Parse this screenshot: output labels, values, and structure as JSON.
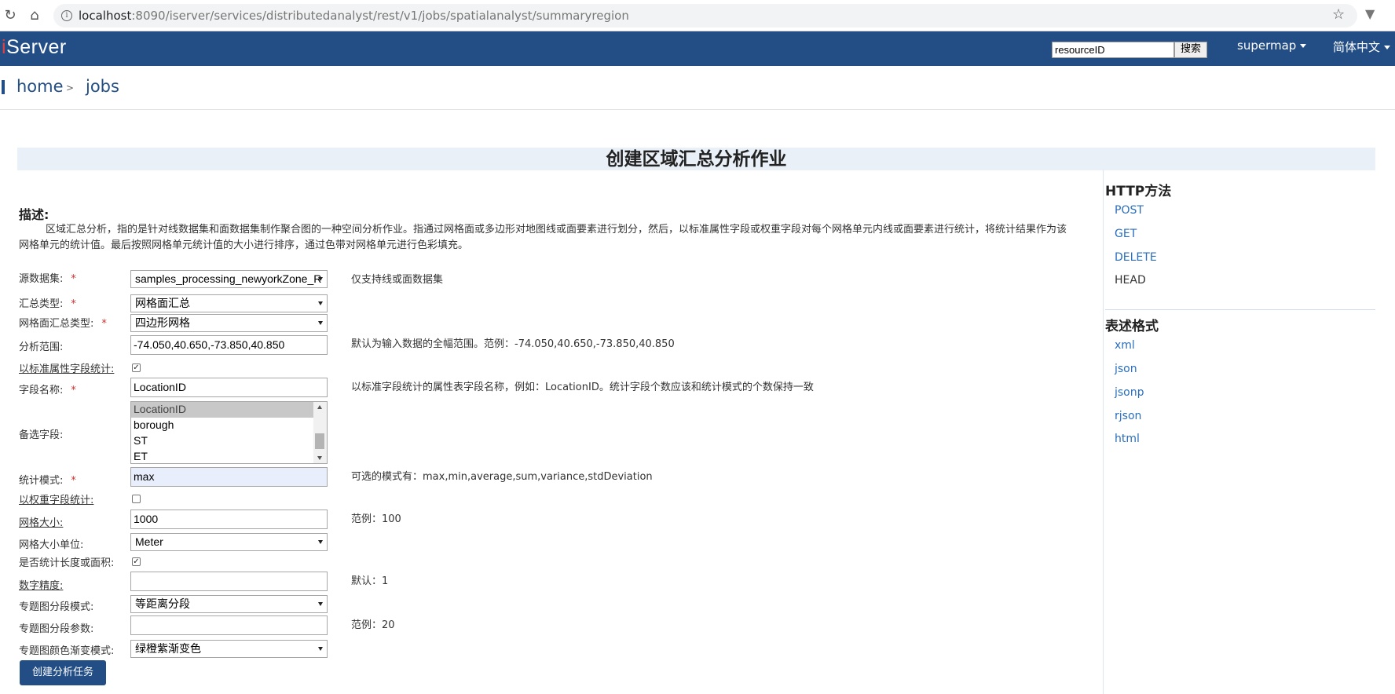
{
  "browser": {
    "url_host": "localhost",
    "url_path": ":8090/iserver/services/distributedanalyst/rest/v1/jobs/spatialanalyst/summaryregion"
  },
  "header": {
    "logo_prefix": "i",
    "logo_text": "Server",
    "search_value": "resourceID",
    "search_button": "搜索",
    "user_menu": "supermap",
    "lang_menu": "简体中文"
  },
  "breadcrumb": {
    "home": "home",
    "separator": ">",
    "jobs": "jobs"
  },
  "page": {
    "title": "创建区域汇总分析作业",
    "desc_heading": "描述:",
    "description": "区域汇总分析，指的是针对线数据集和面数据集制作聚合图的一种空间分析作业。指通过网格面或多边形对地图线或面要素进行划分，然后，以标准属性字段或权重字段对每个网格单元内线或面要素进行统计，将统计结果作为该网格单元的统计值。最后按照网格单元统计值的大小进行排序，通过色带对网格单元进行色彩填充。"
  },
  "form": {
    "required_mark": "*",
    "source_dataset": {
      "label": "源数据集:",
      "value": "samples_processing_newyorkZone_R",
      "hint": "仅支持线或面数据集"
    },
    "summary_type": {
      "label": "汇总类型:",
      "value": "网格面汇总"
    },
    "mesh_type": {
      "label": "网格面汇总类型:",
      "value": "四边形网格"
    },
    "query": {
      "label": "分析范围:",
      "value": "-74.050,40.650,-73.850,40.850",
      "hint": "默认为输入数据的全幅范围。范例：-74.050,40.650,-73.850,40.850"
    },
    "standard_summary": {
      "label": "以标准属性字段统计:",
      "checked": true
    },
    "fields": {
      "label": "字段名称:",
      "value": "LocationID",
      "hint": "以标准字段统计的属性表字段名称，例如：LocationID。统计字段个数应该和统计模式的个数保持一致"
    },
    "candidate_fields": {
      "label": "备选字段:",
      "options": [
        "LocationID",
        "borough",
        "ST",
        "ET"
      ],
      "selected_index": 0
    },
    "stat_modes": {
      "label": "统计模式:",
      "value": "max",
      "hint": "可选的模式有：max,min,average,sum,variance,stdDeviation"
    },
    "weight_summary": {
      "label": "以权重字段统计:",
      "checked": false
    },
    "resolution": {
      "label": "网格大小:",
      "value": "1000",
      "hint": "范例：100"
    },
    "mesh_size_unit": {
      "label": "网格大小单位:",
      "value": "Meter"
    },
    "sum_shape": {
      "label": "是否统计长度或面积:",
      "checked": true
    },
    "precision": {
      "label": "数字精度:",
      "value": "",
      "hint": "默认：1"
    },
    "range_mode": {
      "label": "专题图分段模式:",
      "value": "等距离分段"
    },
    "range_count": {
      "label": "专题图分段参数:",
      "value": "",
      "hint": "范例：20"
    },
    "color_gradient": {
      "label": "专题图颜色渐变模式:",
      "value": "绿橙紫渐变色"
    },
    "submit_label": "创建分析任务"
  },
  "sidebar": {
    "http_heading": "HTTP方法",
    "http_methods": [
      "POST",
      "GET",
      "DELETE",
      "HEAD"
    ],
    "format_heading": "表述格式",
    "formats": [
      "xml",
      "json",
      "jsonp",
      "rjson",
      "html"
    ]
  },
  "colors": {
    "brand": "#234e85",
    "link": "#2a6ebb",
    "required": "#d0332e",
    "title_band": "#eaf0f7"
  }
}
